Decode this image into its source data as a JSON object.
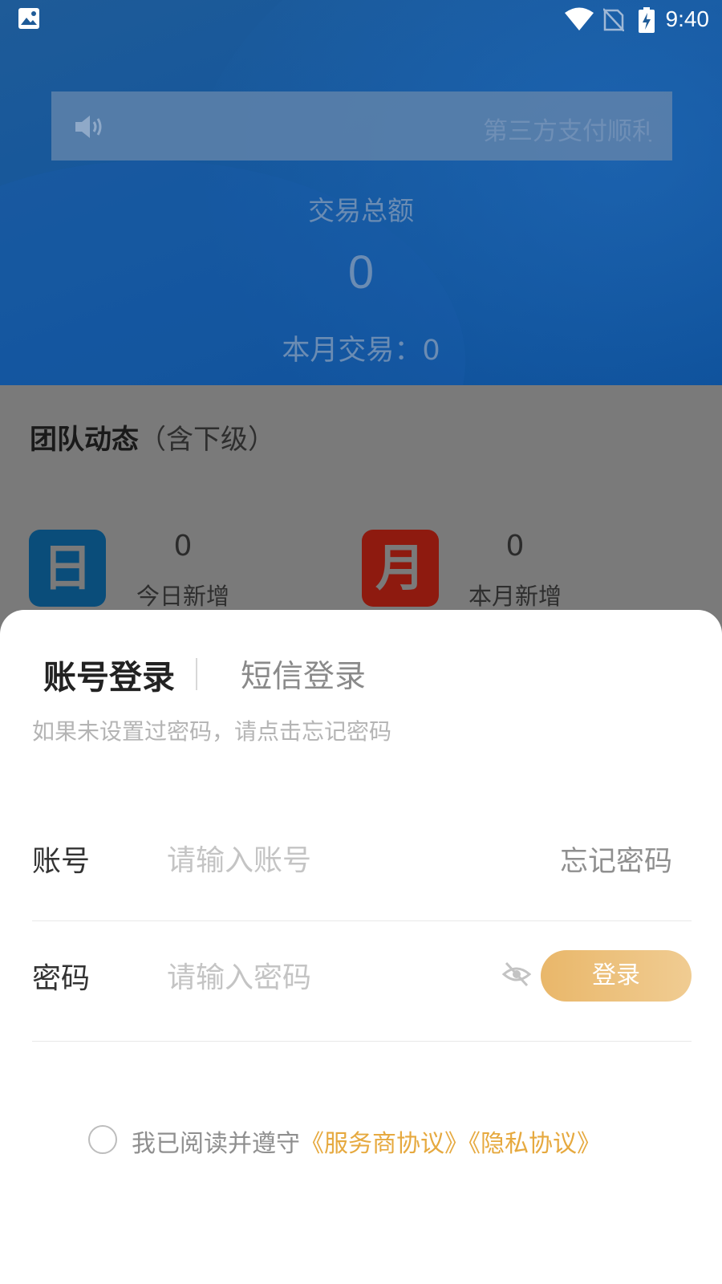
{
  "status_bar": {
    "time": "9:40"
  },
  "notice": {
    "text": "第三方支付顺利"
  },
  "summary": {
    "total_label": "交易总额",
    "total_value": "0",
    "month_label": "本月交易：0"
  },
  "team": {
    "title": "团队动态",
    "title_sub": "（含下级）",
    "today": {
      "badge": "日",
      "count": "0",
      "label": "今日新增",
      "color": "#0a4d7a"
    },
    "month": {
      "badge": "月",
      "count": "0",
      "label": "本月新增",
      "color": "#8e1a0f"
    }
  },
  "login": {
    "tab_account": "账号登录",
    "tab_sms": "短信登录",
    "hint": "如果未设置过密码，请点击忘记密码",
    "account_label": "账号",
    "account_placeholder": "请输入账号",
    "forgot_label": "忘记密码",
    "password_label": "密码",
    "password_placeholder": "请输入密码",
    "submit_label": "登录",
    "agree_text": "我已阅读并遵守",
    "service_agreement": "《服务商协议》",
    "privacy_agreement": "《隐私协议》",
    "accent_color": "#e6a93f"
  }
}
